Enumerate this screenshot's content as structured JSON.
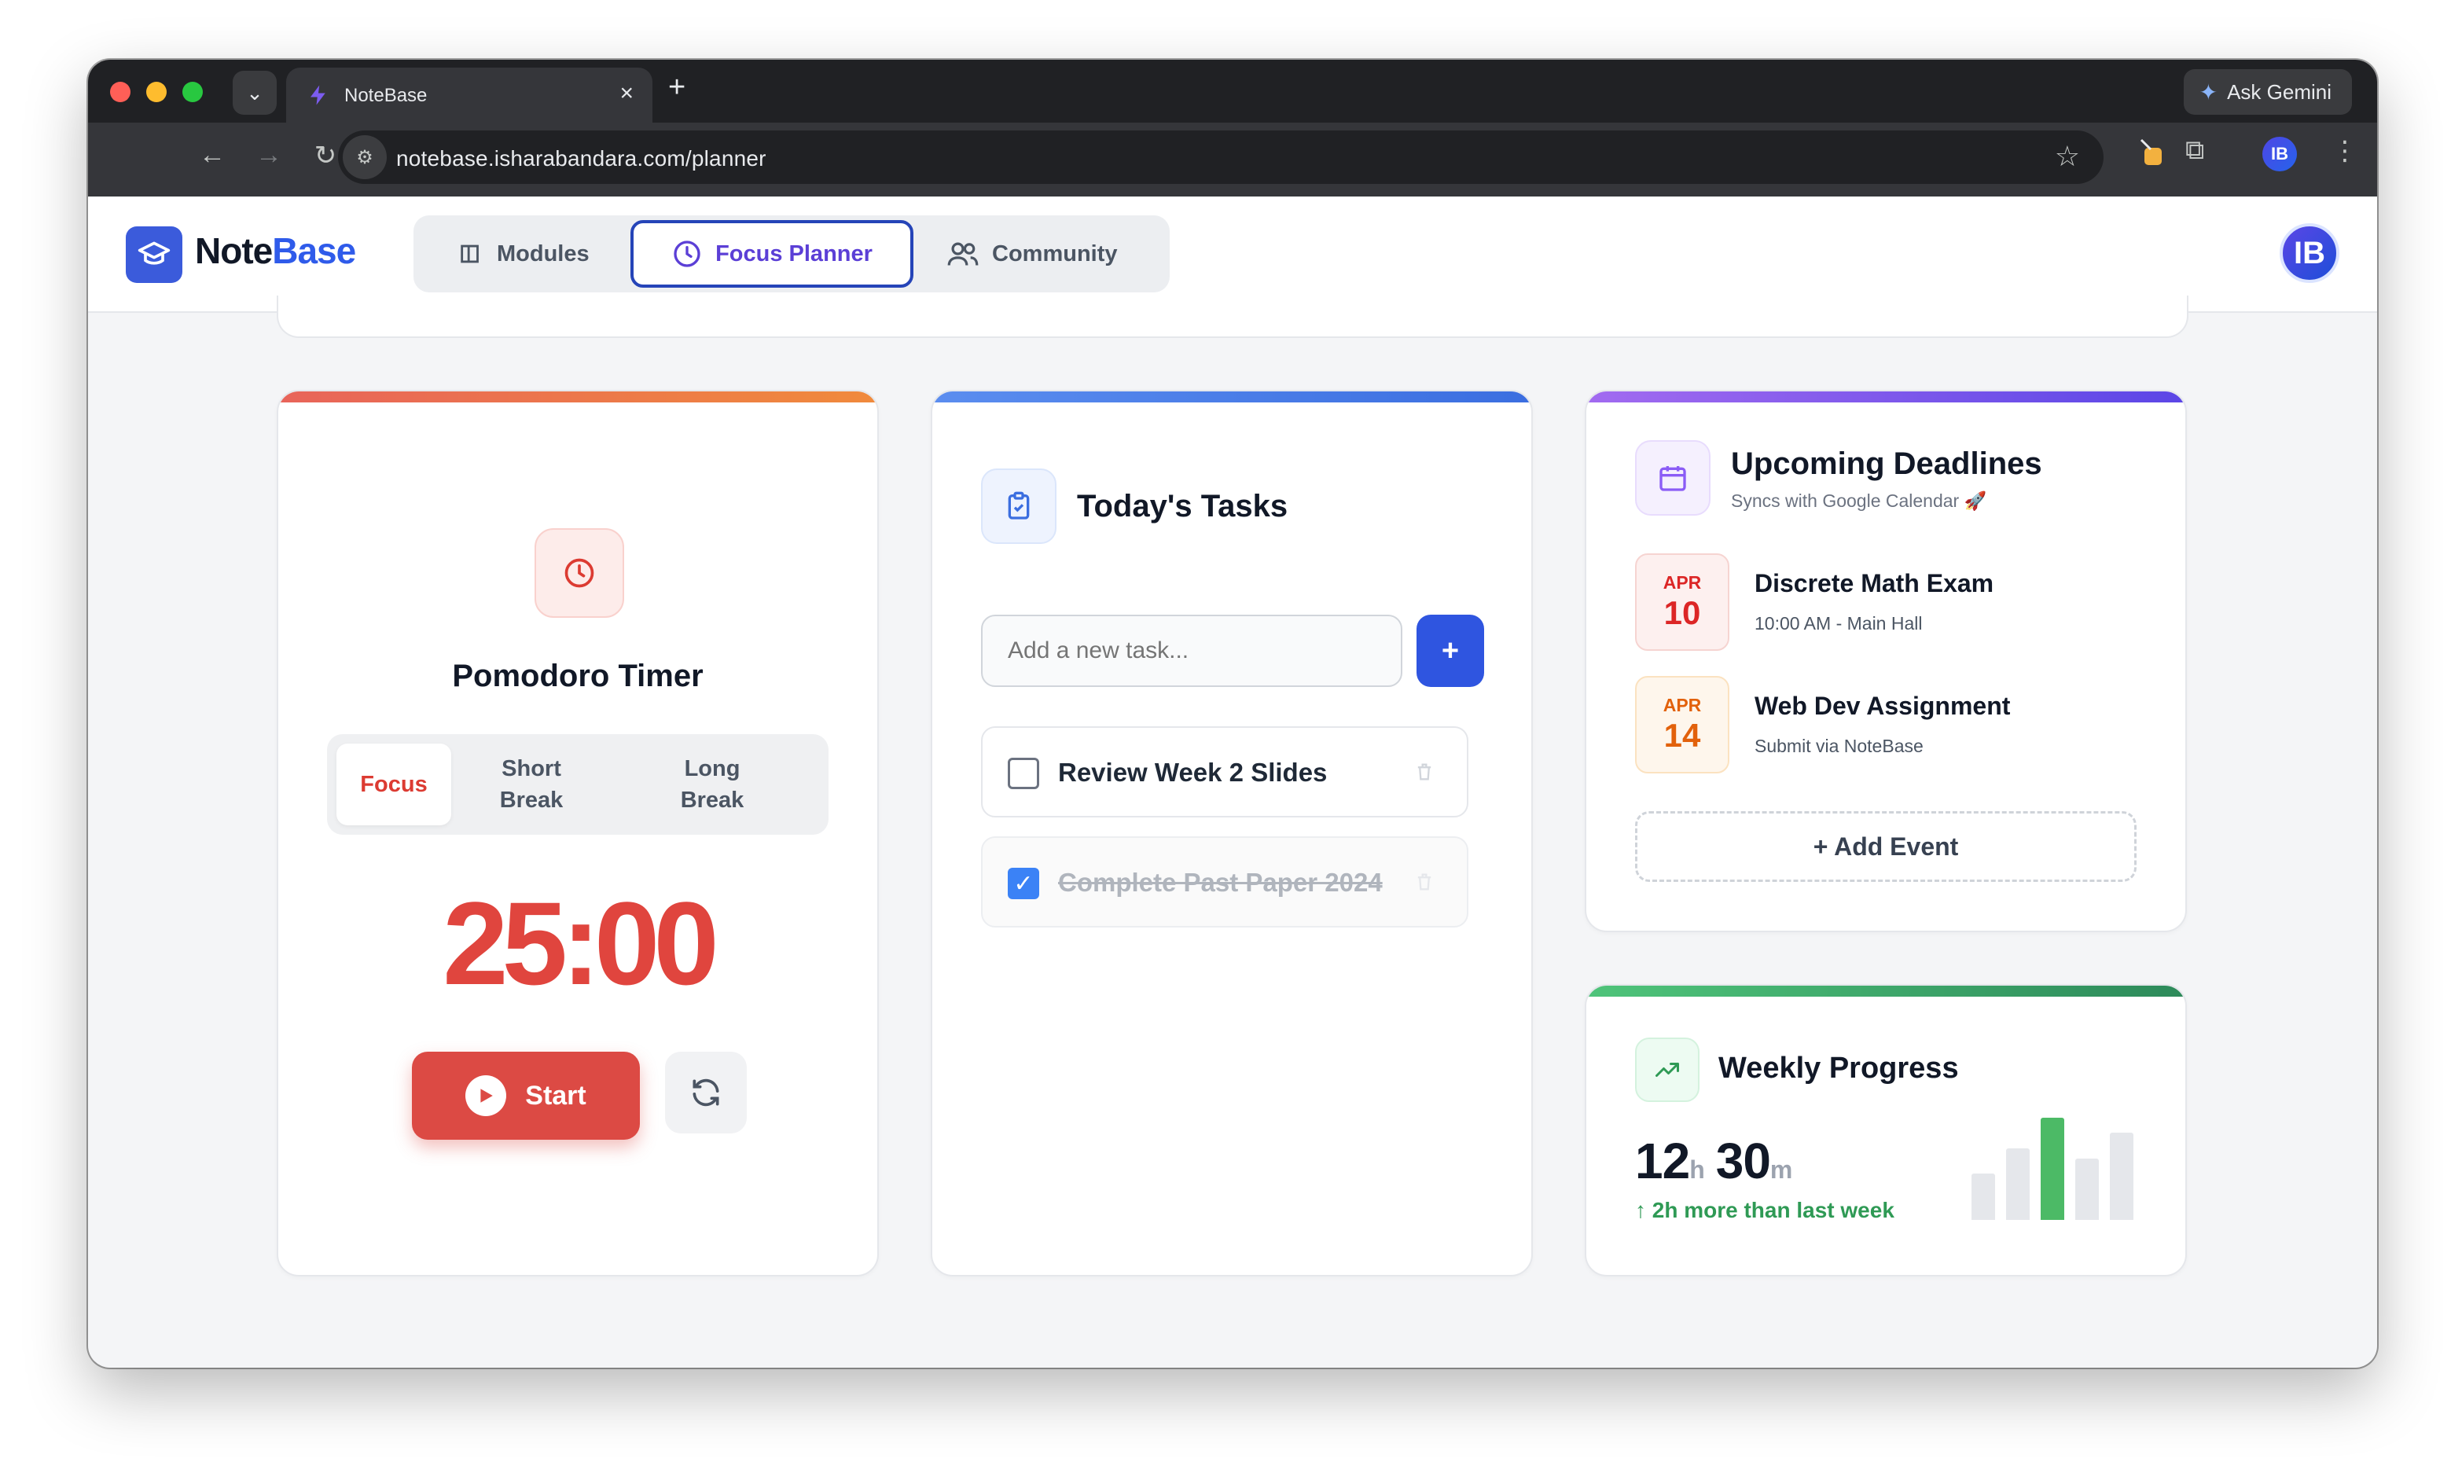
{
  "browser": {
    "tab_title": "NoteBase",
    "url": "notebase.isharabandara.com/planner",
    "gemini_label": "Ask Gemini"
  },
  "app": {
    "logo_note": "Note",
    "logo_base": "Base",
    "nav": {
      "modules": "Modules",
      "focus_planner": "Focus Planner",
      "community": "Community"
    },
    "avatar_initial": "IB"
  },
  "pomodoro": {
    "title": "Pomodoro Timer",
    "modes": {
      "focus": "Focus",
      "short_break": "Short Break",
      "long_break": "Long Break"
    },
    "active_mode": "Focus",
    "time": "25:00",
    "start_label": "Start"
  },
  "tasks": {
    "title": "Today's Tasks",
    "input_placeholder": "Add a new task...",
    "add_label": "+",
    "items": [
      {
        "text": "Review Week 2 Slides",
        "done": false
      },
      {
        "text": "Complete Past Paper 2024",
        "done": true
      }
    ]
  },
  "deadlines": {
    "title": "Upcoming Deadlines",
    "subtitle": "Syncs with Google Calendar 🚀",
    "events": [
      {
        "month": "APR",
        "day": "10",
        "title": "Discrete Math Exam",
        "meta": "10:00 AM - Main Hall"
      },
      {
        "month": "APR",
        "day": "14",
        "title": "Web Dev Assignment",
        "meta": "Submit via NoteBase"
      }
    ],
    "add_event_label": "+ Add Event"
  },
  "weekly": {
    "title": "Weekly Progress",
    "hours": "12",
    "hours_unit": "h",
    "minutes": "30",
    "minutes_unit": "m",
    "delta": "↑ 2h more than last week",
    "bars": [
      0.45,
      0.7,
      1.0,
      0.6,
      0.85
    ],
    "highlight_index": 2
  },
  "colors": {
    "brand": "#2f5bea",
    "timer": "#e0453e",
    "progress_green": "#4cba66",
    "bar_grey": "#e5e7eb"
  }
}
